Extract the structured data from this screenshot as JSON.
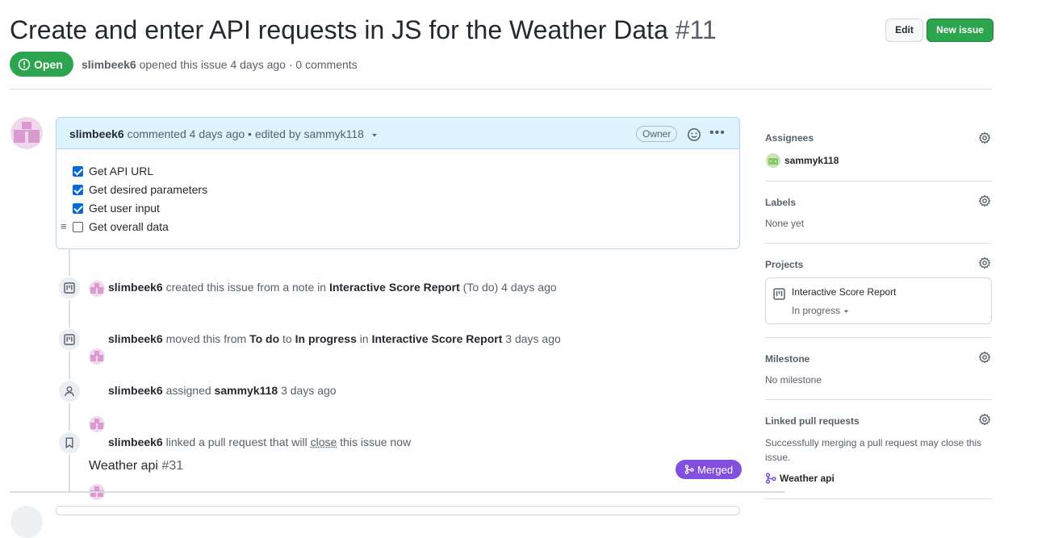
{
  "issue": {
    "title": "Create and enter API requests in JS for the Weather Data",
    "number": "#11",
    "state": "Open",
    "author": "slimbeek6",
    "opened_text": "opened this issue 4 days ago · 0 comments"
  },
  "header": {
    "edit_label": "Edit",
    "new_issue_label": "New issue"
  },
  "comment": {
    "author": "slimbeek6",
    "meta_text": "commented 4 days ago • edited by sammyk118",
    "role_badge": "Owner",
    "tasks": [
      {
        "label": "Get API URL",
        "checked": true
      },
      {
        "label": "Get desired parameters",
        "checked": true
      },
      {
        "label": "Get user input",
        "checked": true
      },
      {
        "label": "Get overall data",
        "checked": false
      }
    ]
  },
  "timeline": {
    "e1": {
      "actor": "slimbeek6",
      "t1": "created this issue from a note in",
      "project": "Interactive Score Report",
      "column": "(To do)",
      "time": "4 days ago"
    },
    "e2": {
      "actor": "slimbeek6",
      "t1": "moved this from",
      "from": "To do",
      "t2": "to",
      "to": "In progress",
      "t3": "in",
      "project": "Interactive Score Report",
      "time": "3 days ago"
    },
    "e3": {
      "actor": "slimbeek6",
      "t1": "assigned",
      "assignee": "sammyk118",
      "time": "3 days ago"
    },
    "e4": {
      "actor": "slimbeek6",
      "t1": "linked a pull request that will",
      "close": "close",
      "t2": "this issue now",
      "pr_title": "Weather api",
      "pr_number": "#31",
      "pr_state": "Merged"
    }
  },
  "sidebar": {
    "assignees": {
      "label": "Assignees",
      "value": "sammyk118"
    },
    "labels": {
      "label": "Labels",
      "value": "None yet"
    },
    "projects": {
      "label": "Projects",
      "name": "Interactive Score Report",
      "column": "In progress"
    },
    "milestone": {
      "label": "Milestone",
      "value": "No milestone"
    },
    "linked_prs": {
      "label": "Linked pull requests",
      "description": "Successfully merging a pull request may close this issue.",
      "pr": "Weather api"
    }
  },
  "colors": {
    "open_green": "#2da44e",
    "merged_purple": "#8250df",
    "link_blue": "#0969da"
  },
  "icons": [
    "issue-opened-icon",
    "smiley-icon",
    "kebab-icon",
    "project-icon",
    "person-icon",
    "bookmark-icon",
    "git-merge-icon",
    "gear-icon",
    "triangle-down-icon",
    "drag-handle-icon"
  ]
}
